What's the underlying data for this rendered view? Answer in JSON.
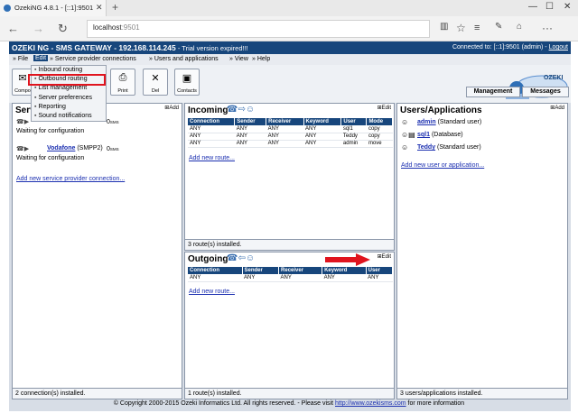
{
  "browser": {
    "tab_title": "OzekiNG 4.8.1 - [::1]:9501",
    "tab_close": "✕",
    "new_tab": "+",
    "win_min": "—",
    "win_max": "☐",
    "win_close": "✕",
    "url_host": "localhost",
    "url_port": ":9501",
    "back_icon": "←",
    "forward_icon": "→",
    "refresh_icon": "↻"
  },
  "app": {
    "title": "OZEKI NG - SMS GATEWAY - 192.168.114.245",
    "trial": " - Trial version expired!!!",
    "connected_to": "Connected to: [::1]:9501 (admin) - ",
    "logout": "Logout",
    "brand_color": "#17467c"
  },
  "menu": {
    "file": "» File",
    "edit": "Edit",
    "service_provider": "» Service provider connections",
    "users": "» Users and applications",
    "view": "» View",
    "help": "» Help"
  },
  "dropdown": {
    "items": [
      "Inbound routing",
      "Outbound routing",
      "List management",
      "Server preferences",
      "Reporting",
      "Sound notifications"
    ]
  },
  "toolbar": {
    "compose": "Compo",
    "print": "Print",
    "del": "Del",
    "contacts": "Contacts"
  },
  "logo": {
    "text": "OZEKI"
  },
  "tabs": {
    "management": "Management",
    "messages": "Messages"
  },
  "service_panel": {
    "title": "Serv",
    "add": "Add",
    "conn1_status": "Waiting for configuration",
    "conn1_speed": "0",
    "conn1_unit": "SMS",
    "conn2_name": "Vodafone",
    "conn2_type": " (SMPP2)",
    "conn2_speed": "0",
    "conn2_unit": "SMS",
    "conn2_status": "Waiting for configuration",
    "add_link": "Add new service provider connection...",
    "footer": "2 connection(s) installed."
  },
  "incoming_panel": {
    "title": "Incoming",
    "edit": "Edit",
    "columns": [
      "Connection",
      "Sender",
      "Receiver",
      "Keyword",
      "User",
      "Mode"
    ],
    "rows": [
      [
        "ANY",
        "ANY",
        "ANY",
        "ANY",
        "sql1",
        "copy"
      ],
      [
        "ANY",
        "ANY",
        "ANY",
        "ANY",
        "Teddy",
        "copy"
      ],
      [
        "ANY",
        "ANY",
        "ANY",
        "ANY",
        "admin",
        "move"
      ]
    ],
    "add_link": "Add new route...",
    "footer": "3 route(s) installed."
  },
  "outgoing_panel": {
    "title": "Outgoing",
    "edit": "Edit",
    "columns": [
      "Connection",
      "Sender",
      "Receiver",
      "Keyword",
      "User"
    ],
    "rows": [
      [
        "ANY",
        "ANY",
        "ANY",
        "ANY",
        "ANY"
      ]
    ],
    "add_link": "Add new route...",
    "footer": "1 route(s) installed."
  },
  "users_panel": {
    "title": "Users/Applications",
    "add": "Add",
    "users": [
      {
        "name": "admin",
        "type": " (Standard user)"
      },
      {
        "name": "sql1",
        "type": " (Database)"
      },
      {
        "name": "Teddy",
        "type": " (Standard user)"
      }
    ],
    "add_link": "Add new user or application...",
    "footer": "3 users/applications installed."
  },
  "footer": {
    "copyright": "© Copyright 2000-2015 Ozeki Informatics Ltd. All rights reserved. - Please visit ",
    "link": "http://www.ozekisms.com",
    "tail": " for more information"
  }
}
